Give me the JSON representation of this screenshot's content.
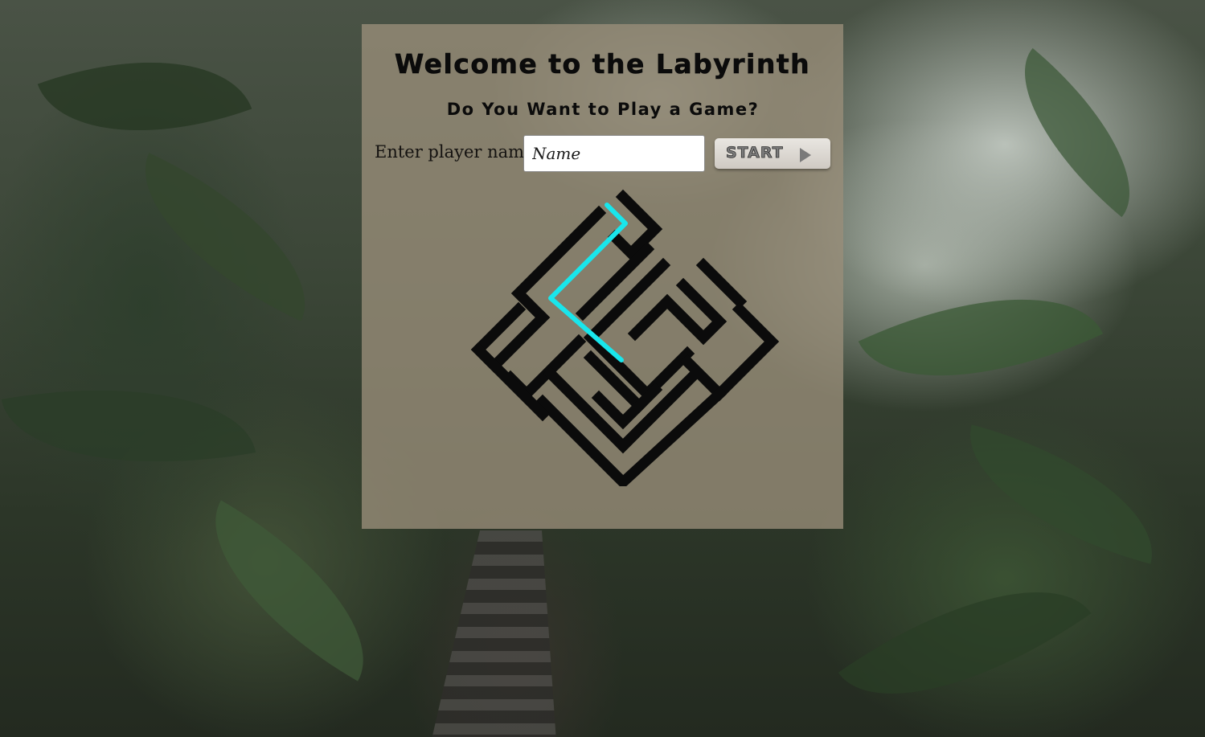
{
  "page": {
    "title": "Welcome to the Labyrinth",
    "subtitle": "Do You Want to Play a Game?"
  },
  "form": {
    "player_label": "Enter player name:",
    "name_placeholder": "Name",
    "name_value": "",
    "start_label": "START"
  },
  "icons": {
    "start_button_icon": "play-arrow-icon",
    "logo": "labyrinth-maze-logo"
  },
  "colors": {
    "panel_bg": "#9a8e7a",
    "maze_walls": "#0b0b0b",
    "solution_path": "#19e6ec",
    "button_bg": "#dedad4"
  }
}
